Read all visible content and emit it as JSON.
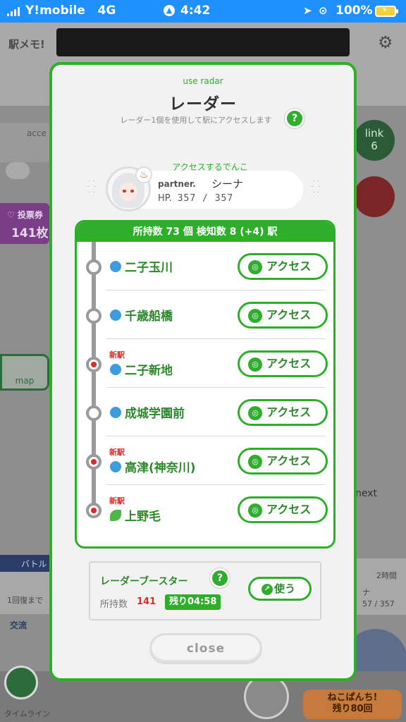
{
  "status_bar": {
    "carrier": "Y!mobile",
    "network": "4G",
    "time": "4:42",
    "battery": "100%"
  },
  "background_app": {
    "logo": "駅メモ!",
    "left_card_text": "acce",
    "vote_label": "♡ 投票券",
    "vote_count": "141枚",
    "link_label": "link",
    "link_count": "6",
    "map_label": "map",
    "next_label": "next",
    "battle_label": "バトル",
    "recover_text": "1回復まで",
    "exchange_text": "交流",
    "time_text": "2時間",
    "hp_text": "57 / 357",
    "partner_short": "ナ",
    "timeline_label": "タイムライン",
    "neko_text": "ねこぱんち!",
    "neko_remain": "残り80回"
  },
  "modal": {
    "subtitle": "use radar",
    "title": "レーダー",
    "description": "レーダー1個を使用して駅にアクセスします",
    "help_label": "?",
    "access_label": "アクセスするでんこ",
    "partner": {
      "prefix": "partner.",
      "name": "シーナ",
      "hp_label": "HP.",
      "hp_value": "357 / 357"
    },
    "list_header": "所持数 73 個 検知数 8 (+4) 駅",
    "new_tag": "新駅",
    "access_button_label": "アクセス",
    "stations": [
      {
        "name": "二子玉川",
        "is_new": false,
        "icon": "blue-circle"
      },
      {
        "name": "千歳船橋",
        "is_new": false,
        "icon": "blue-circle"
      },
      {
        "name": "二子新地",
        "is_new": true,
        "icon": "blue-circle"
      },
      {
        "name": "成城学園前",
        "is_new": false,
        "icon": "blue-circle"
      },
      {
        "name": "高津(神奈川)",
        "is_new": true,
        "icon": "blue-circle"
      },
      {
        "name": "上野毛",
        "is_new": true,
        "icon": "green-leaf"
      }
    ],
    "booster": {
      "title": "レーダーブースター",
      "count_label": "所持数",
      "count": "141",
      "remaining": "残り04:58",
      "use_label": "使う"
    },
    "close_label": "close"
  },
  "colors": {
    "accent": "#2fae2c",
    "new_station": "#e02a2a"
  }
}
